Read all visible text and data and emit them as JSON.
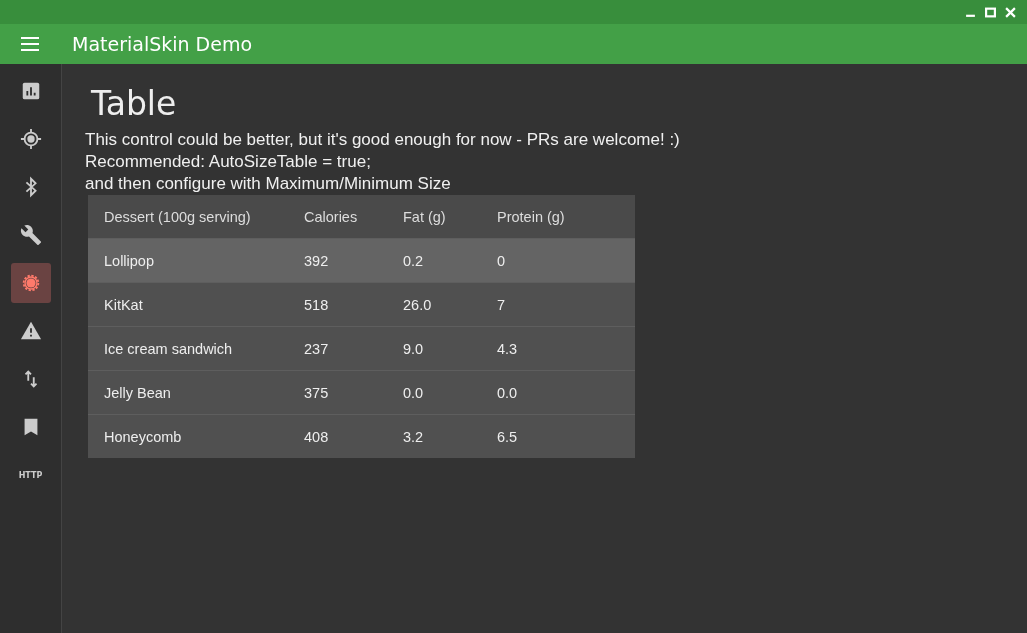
{
  "window": {
    "title": "MaterialSkin Demo"
  },
  "sidebar": {
    "items": [
      {
        "kind": "chart",
        "selected": false
      },
      {
        "kind": "target",
        "selected": false
      },
      {
        "kind": "bluetooth",
        "selected": false
      },
      {
        "kind": "wrench",
        "selected": false
      },
      {
        "kind": "gear",
        "selected": true
      },
      {
        "kind": "warning",
        "selected": false
      },
      {
        "kind": "swap",
        "selected": false
      },
      {
        "kind": "bookmark",
        "selected": false
      },
      {
        "kind": "text",
        "label": "HTTP",
        "selected": false
      }
    ]
  },
  "page": {
    "title": "Table",
    "description": [
      "This control could be better, but it's good enough for now - PRs are welcome! :)",
      "Recommended: AutoSizeTable = true;",
      "and then configure with Maximum/Minimum Size"
    ]
  },
  "table": {
    "columns": [
      "Dessert (100g serving)",
      "Calories",
      "Fat (g)",
      "Protein (g)"
    ],
    "rows": [
      {
        "cells": [
          "Lollipop",
          "392",
          "0.2",
          "0"
        ],
        "selected": true
      },
      {
        "cells": [
          "KitKat",
          "518",
          "26.0",
          "7"
        ],
        "selected": false
      },
      {
        "cells": [
          "Ice cream sandwich",
          "237",
          "9.0",
          "4.3"
        ],
        "selected": false
      },
      {
        "cells": [
          "Jelly Bean",
          "375",
          "0.0",
          "0.0"
        ],
        "selected": false
      },
      {
        "cells": [
          "Honeycomb",
          "408",
          "3.2",
          "6.5"
        ],
        "selected": false
      }
    ]
  }
}
